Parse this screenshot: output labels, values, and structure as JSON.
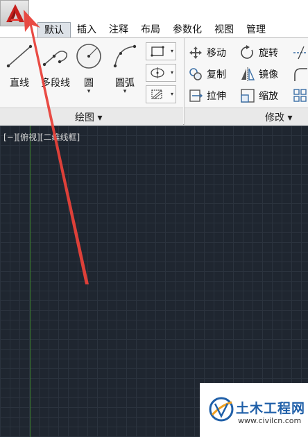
{
  "tabs": [
    {
      "label": "默认",
      "active": true
    },
    {
      "label": "插入",
      "active": false
    },
    {
      "label": "注释",
      "active": false
    },
    {
      "label": "布局",
      "active": false
    },
    {
      "label": "参数化",
      "active": false
    },
    {
      "label": "视图",
      "active": false
    },
    {
      "label": "管理",
      "active": false
    }
  ],
  "draw_panel": {
    "title": "绘图 ▾",
    "tools": [
      {
        "label": "直线",
        "icon": "line-icon"
      },
      {
        "label": "多段线",
        "icon": "polyline-icon"
      },
      {
        "label": "圆",
        "icon": "circle-icon"
      },
      {
        "label": "圆弧",
        "icon": "arc-icon"
      }
    ],
    "dropdown_arrow": "▾"
  },
  "modify_panel": {
    "title": "修改 ▾",
    "items": [
      {
        "label": "移动",
        "icon": "move-icon"
      },
      {
        "label": "旋转",
        "icon": "rotate-icon"
      },
      {
        "label": "复制",
        "icon": "copy-icon"
      },
      {
        "label": "镜像",
        "icon": "mirror-icon"
      },
      {
        "label": "拉伸",
        "icon": "stretch-icon"
      },
      {
        "label": "缩放",
        "icon": "scale-icon"
      }
    ]
  },
  "viewport": {
    "label": "[−][俯视][二维线框]"
  },
  "watermark": {
    "name": "土木工程网",
    "url": "www.civilcn.com"
  },
  "colors": {
    "canvas_bg": "#1f2630",
    "grid": "#2b333e",
    "annotation_arrow": "#e8413a",
    "app_logo": "#c8201d",
    "ribbon_bg": "#f7f7f7"
  }
}
